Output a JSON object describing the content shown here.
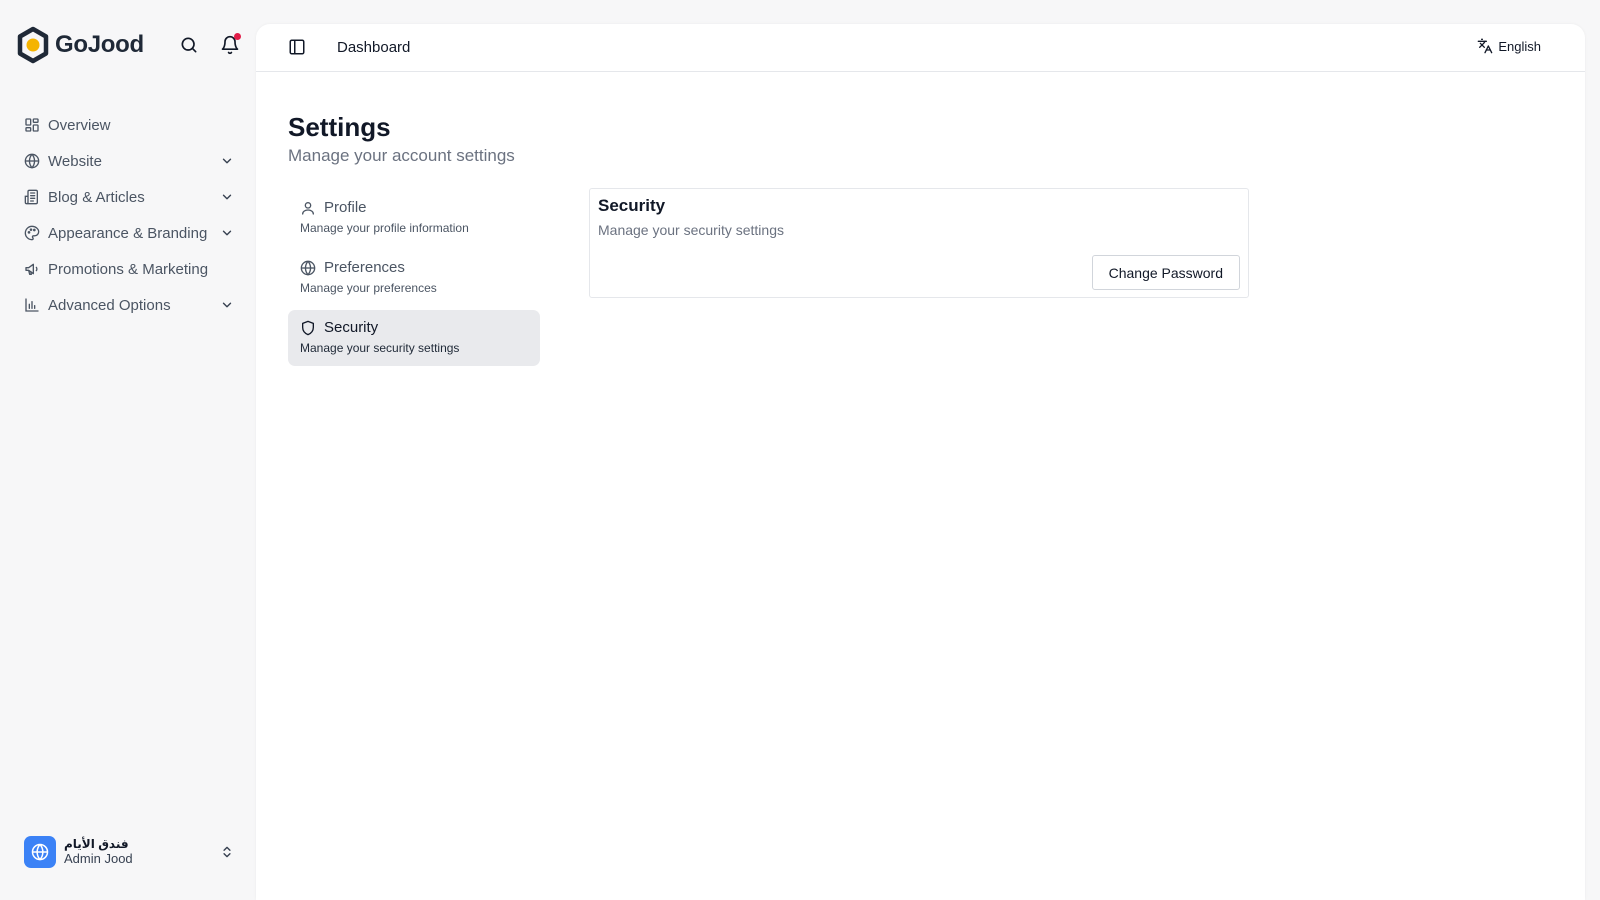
{
  "brand": {
    "name": "GoJood",
    "accent": "#f5b400",
    "dark": "#1f2937"
  },
  "header_icons": {
    "search": "search-icon",
    "notifications": "bell-icon",
    "notification_dot_color": "#e11d48"
  },
  "sidebar": {
    "items": [
      {
        "label": "Overview",
        "icon": "grid-icon",
        "expandable": false
      },
      {
        "label": "Website",
        "icon": "globe-icon",
        "expandable": true
      },
      {
        "label": "Blog & Articles",
        "icon": "newspaper-icon",
        "expandable": true
      },
      {
        "label": "Appearance & Branding",
        "icon": "palette-icon",
        "expandable": true
      },
      {
        "label": "Promotions & Marketing",
        "icon": "megaphone-icon",
        "expandable": false
      },
      {
        "label": "Advanced Options",
        "icon": "bar-chart-icon",
        "expandable": true
      }
    ]
  },
  "user": {
    "org": "فندق الأيام",
    "name": "Admin Jood",
    "avatar_icon": "globe-icon",
    "avatar_color": "#3b82f6"
  },
  "topbar": {
    "breadcrumb": "Dashboard",
    "language": "English"
  },
  "page": {
    "title": "Settings",
    "subtitle": "Manage your account settings"
  },
  "settings_nav": [
    {
      "label": "Profile",
      "description": "Manage your profile information",
      "icon": "user-icon",
      "active": false
    },
    {
      "label": "Preferences",
      "description": "Manage your preferences",
      "icon": "globe-icon",
      "active": false
    },
    {
      "label": "Security",
      "description": "Manage your security settings",
      "icon": "shield-icon",
      "active": true
    }
  ],
  "security_card": {
    "title": "Security",
    "subtitle": "Manage your security settings",
    "button_label": "Change Password"
  }
}
